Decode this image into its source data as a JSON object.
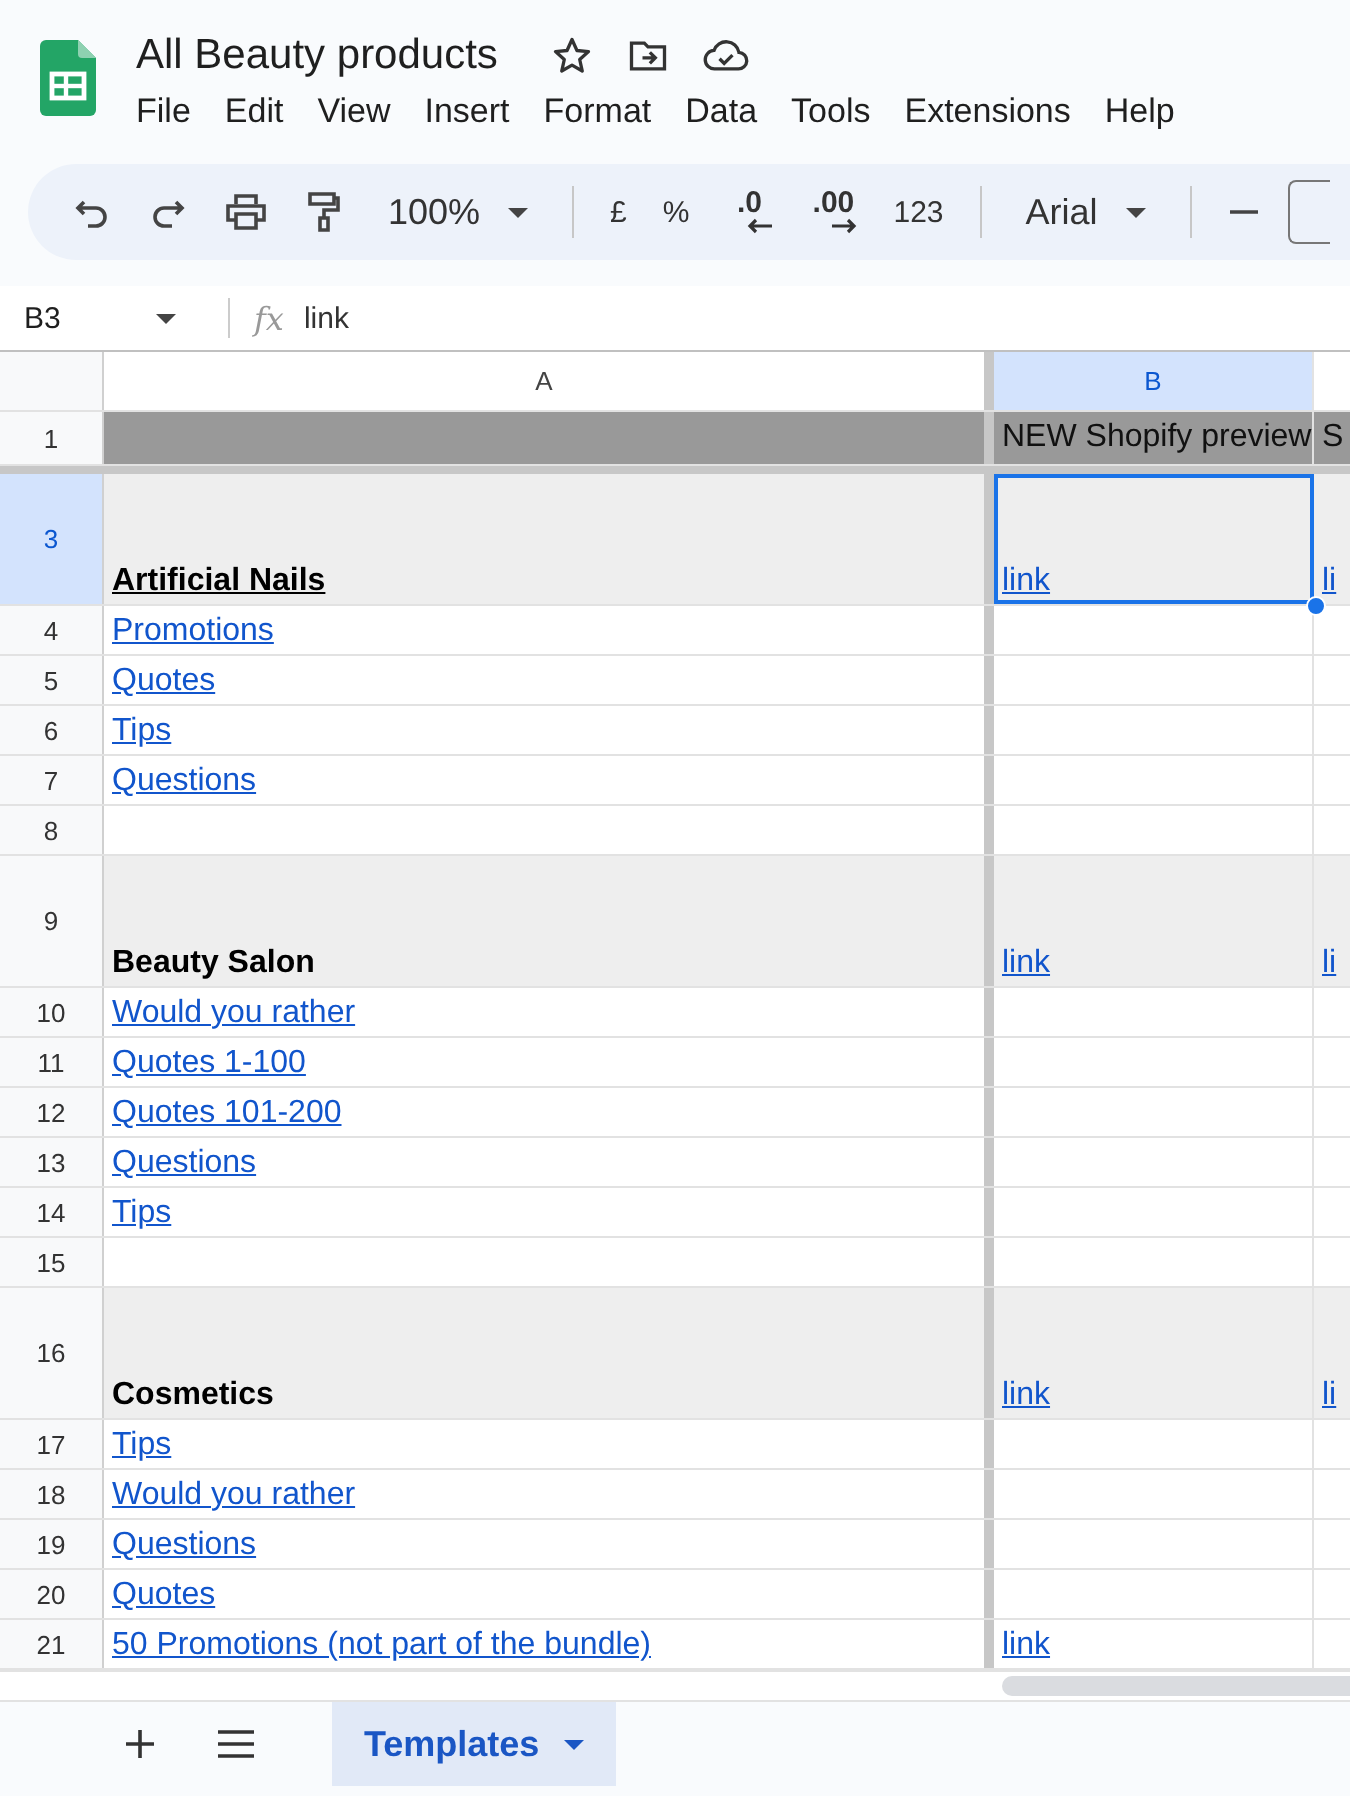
{
  "document": {
    "title": "All Beauty products"
  },
  "menu": [
    "File",
    "Edit",
    "View",
    "Insert",
    "Format",
    "Data",
    "Tools",
    "Extensions",
    "Help"
  ],
  "toolbar": [
    {
      "kind": "undo"
    },
    {
      "kind": "redo"
    },
    {
      "kind": "print"
    },
    {
      "kind": "paint"
    },
    {
      "kind": "select",
      "label": "100%"
    },
    {
      "kind": "sep"
    },
    {
      "kind": "text",
      "label": "£"
    },
    {
      "kind": "text",
      "label": "%"
    },
    {
      "kind": "decdown",
      "label": ".0"
    },
    {
      "kind": "decup",
      "label": ".00"
    },
    {
      "kind": "text",
      "label": "123"
    },
    {
      "kind": "sep"
    },
    {
      "kind": "select",
      "label": "Arial"
    },
    {
      "kind": "sep"
    },
    {
      "kind": "minus"
    }
  ],
  "formula_bar": {
    "cell_ref": "B3",
    "function_label": "fx",
    "value": "link"
  },
  "columns": [
    {
      "label": "A",
      "selected": false
    },
    {
      "label": "B",
      "selected": true
    }
  ],
  "rows": [
    {
      "number": "1",
      "kind": "header",
      "selected": false,
      "col_b": "NEW Shopify preview",
      "col_c": "S"
    },
    {
      "number": "3",
      "kind": "category",
      "selected": true,
      "underlined": true,
      "col_a": "Artificial Nails",
      "col_b": "link",
      "col_c": "li"
    },
    {
      "number": "4",
      "kind": "item",
      "selected": false,
      "col_a": "Promotions"
    },
    {
      "number": "5",
      "kind": "item",
      "selected": false,
      "col_a": "Quotes"
    },
    {
      "number": "6",
      "kind": "item",
      "selected": false,
      "col_a": "Tips"
    },
    {
      "number": "7",
      "kind": "item",
      "selected": false,
      "col_a": "Questions"
    },
    {
      "number": "8",
      "kind": "item",
      "selected": false
    },
    {
      "number": "9",
      "kind": "category",
      "selected": false,
      "underlined": false,
      "col_a": "Beauty Salon",
      "col_b": "link",
      "col_c": "li"
    },
    {
      "number": "10",
      "kind": "item",
      "selected": false,
      "col_a": "Would you rather"
    },
    {
      "number": "11",
      "kind": "item",
      "selected": false,
      "col_a": "Quotes 1-100"
    },
    {
      "number": "12",
      "kind": "item",
      "selected": false,
      "col_a": "Quotes 101-200"
    },
    {
      "number": "13",
      "kind": "item",
      "selected": false,
      "col_a": "Questions"
    },
    {
      "number": "14",
      "kind": "item",
      "selected": false,
      "col_a": "Tips"
    },
    {
      "number": "15",
      "kind": "item",
      "selected": false
    },
    {
      "number": "16",
      "kind": "category",
      "selected": false,
      "underlined": false,
      "col_a": "Cosmetics",
      "col_b": "link",
      "col_c": "li"
    },
    {
      "number": "17",
      "kind": "item",
      "selected": false,
      "col_a": "Tips"
    },
    {
      "number": "18",
      "kind": "item",
      "selected": false,
      "col_a": "Would you rather"
    },
    {
      "number": "19",
      "kind": "item",
      "selected": false,
      "col_a": "Questions"
    },
    {
      "number": "20",
      "kind": "item",
      "selected": false,
      "col_a": "Quotes"
    },
    {
      "number": "21",
      "kind": "item",
      "selected": false,
      "col_a": "50 Promotions (not part of the bundle)",
      "col_b": "link"
    }
  ],
  "sheet_tabs": [
    {
      "label": "Templates",
      "selected": true
    }
  ]
}
